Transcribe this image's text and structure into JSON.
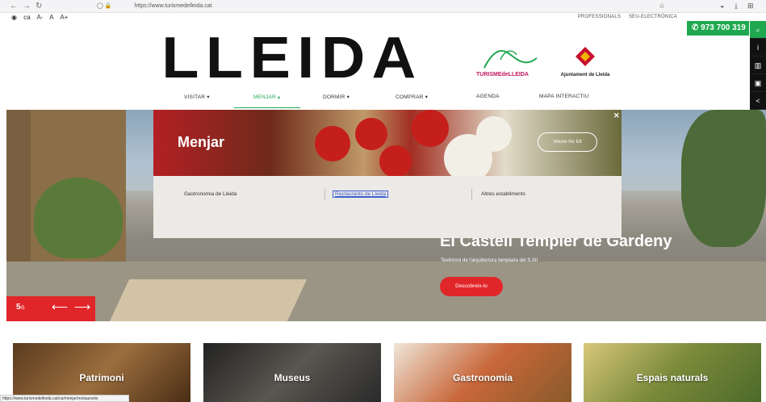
{
  "browser": {
    "url": "https://www.turismedelleida.cat",
    "nav_icons": [
      "back-icon",
      "forward-icon",
      "reload-icon"
    ]
  },
  "utility": {
    "lang": "ca",
    "text_sizes": [
      "A-",
      "A",
      "A+"
    ],
    "links": [
      "PROFESSIONALS",
      "SEU-ELECTRÒNICA"
    ],
    "phone": "973 700 319"
  },
  "logo": {
    "text": "LLEIDA",
    "turisme": "TURISMEdeLLEIDA",
    "ajuntament": "Ajuntament de Lleida"
  },
  "nav": {
    "items": [
      {
        "label": "VISITAR ▾",
        "active": false
      },
      {
        "label": "MENJAR ▴",
        "active": true
      },
      {
        "label": "DORMIR ▾",
        "active": false
      },
      {
        "label": "COMPRAR ▾",
        "active": false
      },
      {
        "label": "AGENDA",
        "active": false
      },
      {
        "label": "MAPA INTERACTIU",
        "active": false
      }
    ]
  },
  "hero": {
    "title": "El Castell Templer de Gardeny",
    "subtitle": "Testimoni de l'arquitectura templaria del S.XII",
    "button": "Descobreix-lo",
    "counter_current": "5",
    "counter_total": "/5"
  },
  "dropdown": {
    "title": "Menjar",
    "button": "Veure-ho tot",
    "links": [
      "Gastronomia de Lleida",
      "Restaurants de Lleida",
      "Altres establiments"
    ]
  },
  "cards": [
    "Patrimoni",
    "Museus",
    "Gastronomia",
    "Espais naturals"
  ],
  "status_url": "https://www.turismedelleida.cat/ca/menjar/restaurants"
}
